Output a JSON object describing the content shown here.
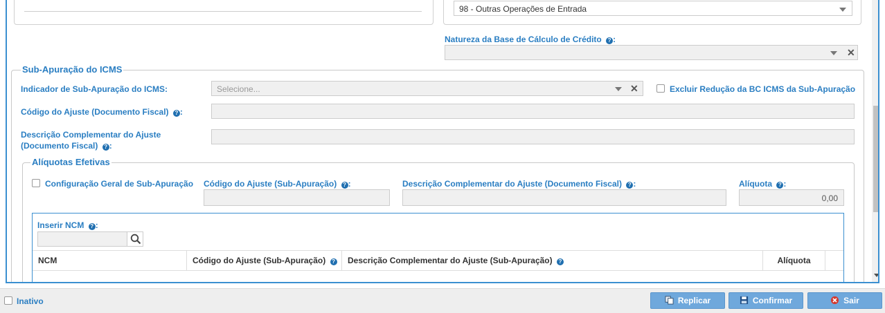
{
  "top_section": {
    "cfop_value": "98 - Outras Operações de Entrada",
    "natureza_label": "Natureza da Base de Cálculo de Crédito",
    "natureza_value": ""
  },
  "sub_apuracao": {
    "legend": "Sub-Apuração do ICMS",
    "indicador_label": "Indicador de Sub-Apuração do ICMS:",
    "indicador_placeholder": "Selecione...",
    "excluir_label": "Excluir Redução da BC ICMS da Sub-Apuração",
    "codigo_ajuste_label": "Código do Ajuste (Documento Fiscal)",
    "codigo_ajuste_value": "",
    "descricao_label_line1": "Descrição Complementar do Ajuste",
    "descricao_label_line2": "(Documento Fiscal)",
    "descricao_value": ""
  },
  "aliquotas": {
    "legend": "Alíquotas Efetivas",
    "config_geral_label": "Configuração Geral de Sub-Apuração",
    "codigo_sub_label": "Código do Ajuste (Sub-Apuração)",
    "descricao_doc_label": "Descrição Complementar do Ajuste (Documento Fiscal)",
    "aliquota_label": "Alíquota",
    "aliquota_value": "0,00",
    "inserir_ncm_label": "Inserir NCM",
    "table_headers": [
      "NCM",
      "Código do Ajuste (Sub-Apuração)",
      "Descrição Complementar do Ajuste (Sub-Apuração)",
      "Alíquota"
    ]
  },
  "footer": {
    "inativo_label": "Inativo",
    "replicar_label": "Replicar",
    "confirmar_label": "Confirmar",
    "sair_label": "Sair"
  },
  "colors": {
    "accent": "#2a7ec2",
    "button": "#6fa8dc",
    "border": "#3a8fd0"
  }
}
